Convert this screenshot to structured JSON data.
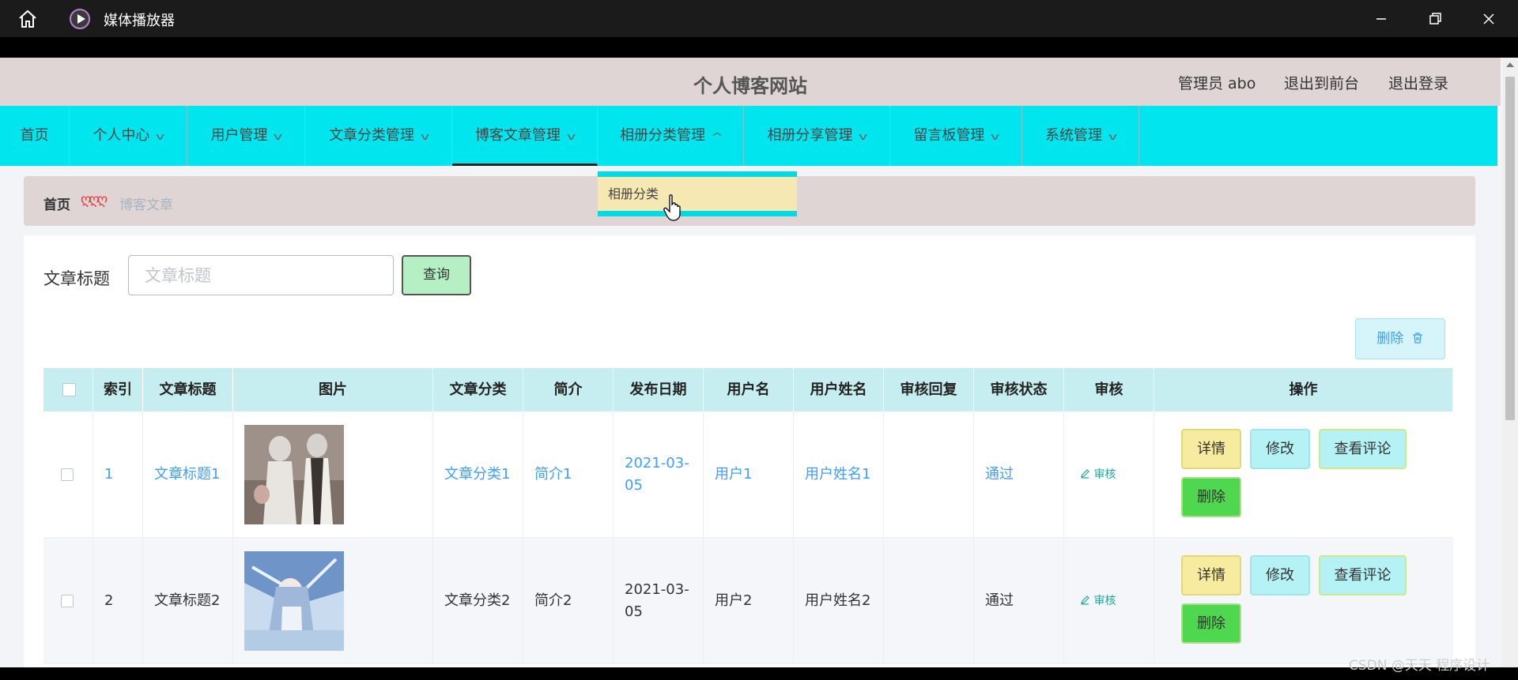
{
  "window": {
    "title": "媒体播放器"
  },
  "header": {
    "site_title": "个人博客网站",
    "admin_label": "管理员 abo",
    "front_link": "退出到前台",
    "logout_link": "退出登录"
  },
  "nav": {
    "items": [
      {
        "label": "首页"
      },
      {
        "label": "个人中心",
        "chevron": "chevron-down"
      },
      {
        "label": "用户管理",
        "chevron": "chevron-down"
      },
      {
        "label": "文章分类管理",
        "chevron": "chevron-down"
      },
      {
        "label": "博客文章管理",
        "chevron": "chevron-down",
        "active": true
      },
      {
        "label": "相册分类管理",
        "chevron": "chevron-up",
        "open": true
      },
      {
        "label": "相册分享管理",
        "chevron": "chevron-down"
      },
      {
        "label": "留言板管理",
        "chevron": "chevron-down"
      },
      {
        "label": "系统管理",
        "chevron": "chevron-down"
      }
    ],
    "dropdown_item": "相册分类"
  },
  "breadcrumb": {
    "home": "首页",
    "separator": "ღღღ",
    "current": "博客文章"
  },
  "search": {
    "label": "文章标题",
    "placeholder": "文章标题",
    "value": "",
    "button": "查询"
  },
  "toolbar": {
    "delete_label": "删除"
  },
  "table": {
    "headers": [
      "索引",
      "文章标题",
      "图片",
      "文章分类",
      "简介",
      "发布日期",
      "用户名",
      "用户姓名",
      "审核回复",
      "审核状态",
      "审核",
      "操作"
    ],
    "rows": [
      {
        "index": "1",
        "title": "文章标题1",
        "category": "文章分类1",
        "intro": "简介1",
        "date_line1": "2021-03-",
        "date_line2": "05",
        "username": "用户1",
        "realname": "用户姓名1",
        "reply": "",
        "status": "通过",
        "audit": "审核"
      },
      {
        "index": "2",
        "title": "文章标题2",
        "category": "文章分类2",
        "intro": "简介2",
        "date_line1": "2021-03-",
        "date_line2": "05",
        "username": "用户2",
        "realname": "用户姓名2",
        "reply": "",
        "status": "通过",
        "audit": "审核"
      }
    ],
    "actions": {
      "detail": "详情",
      "edit": "修改",
      "comments": "查看评论",
      "delete": "删除"
    }
  },
  "watermark": "CSDN @天天 程序设计",
  "colors": {
    "nav_bg": "#00e5ee",
    "header_bg": "#dfd5d5",
    "table_header_bg": "#c6eef0",
    "link": "#409eff"
  }
}
